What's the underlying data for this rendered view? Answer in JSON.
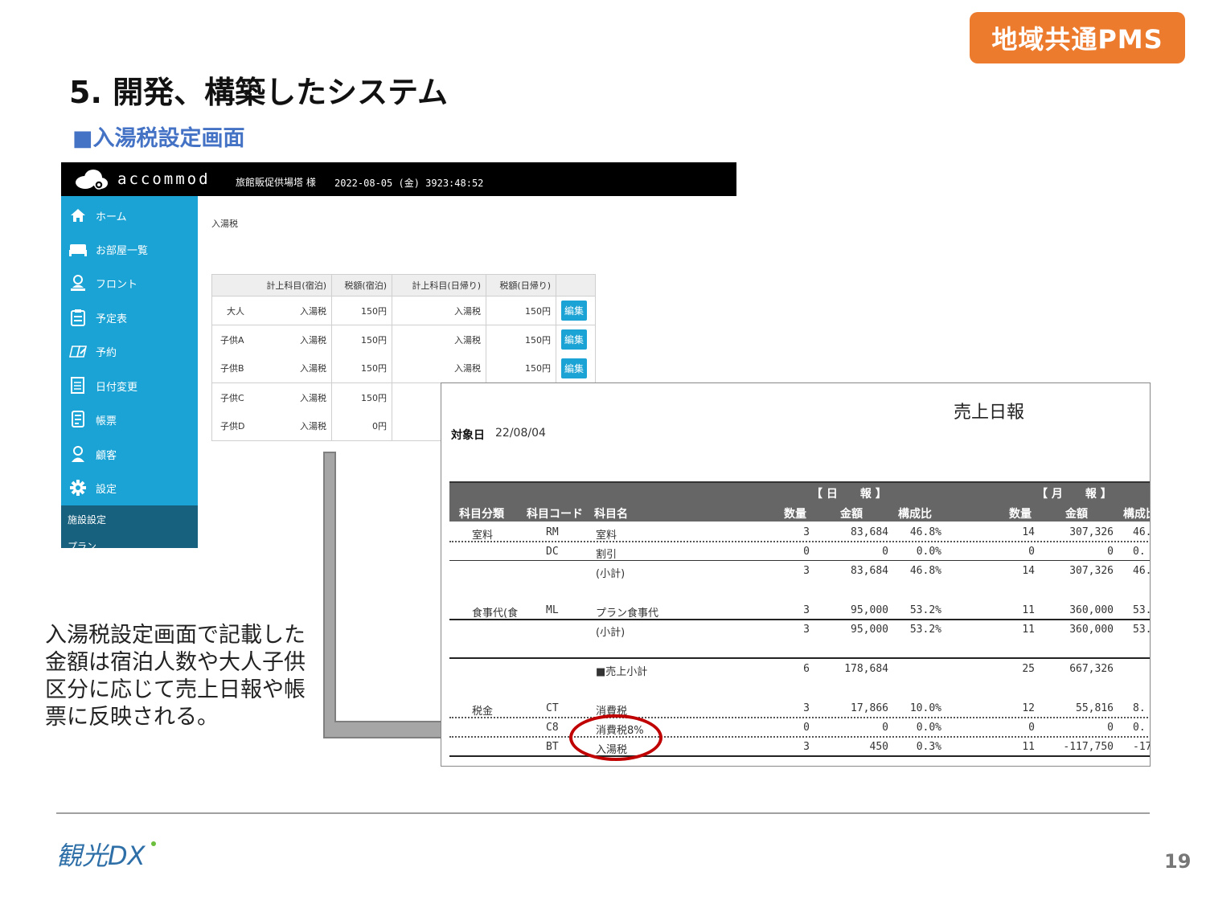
{
  "badge": "地域共通PMS",
  "slide_title": "5. 開発、構築したシステム",
  "subtitle": "■入湯税設定画面",
  "app": {
    "logo": "accommod",
    "facility": "旅館販促供場塔 様",
    "datetime": "2022-08-05 (金) 3923:48:52",
    "sidebar": [
      {
        "label": "ホーム",
        "icon": "home-icon"
      },
      {
        "label": "お部屋一覧",
        "icon": "bed-icon"
      },
      {
        "label": "フロント",
        "icon": "front-desk-icon"
      },
      {
        "label": "予定表",
        "icon": "clipboard-icon"
      },
      {
        "label": "予約",
        "icon": "book-edit-icon"
      },
      {
        "label": "日付変更",
        "icon": "document-icon"
      },
      {
        "label": "帳票",
        "icon": "report-icon"
      },
      {
        "label": "顧客",
        "icon": "user-icon"
      },
      {
        "label": "設定",
        "icon": "gear-icon"
      }
    ],
    "sidebar_section": "施設設定",
    "sidebar_section_next": "プラン",
    "page_heading": "入湯税",
    "table": {
      "headers": [
        "計上科目(宿泊)",
        "税額(宿泊)",
        "計上科目(日帰り)",
        "税額(日帰り)"
      ],
      "rows": [
        {
          "type": "大人",
          "item_stay": "入湯税",
          "tax_stay": "150円",
          "item_day": "入湯税",
          "tax_day": "150円",
          "edit": "編集"
        },
        {
          "type": "子供A",
          "item_stay": "入湯税",
          "tax_stay": "150円",
          "item_day": "入湯税",
          "tax_day": "150円",
          "edit": "編集"
        },
        {
          "type": "子供B",
          "item_stay": "入湯税",
          "tax_stay": "150円",
          "item_day": "入湯税",
          "tax_day": "150円",
          "edit": "編集"
        },
        {
          "type": "子供C",
          "item_stay": "入湯税",
          "tax_stay": "150円"
        },
        {
          "type": "子供D",
          "item_stay": "入湯税",
          "tax_stay": "0円"
        }
      ]
    }
  },
  "report": {
    "title": "売上日報",
    "date_label": "対象日",
    "date_value": "22/08/04",
    "group_day": "【 日　　報 】",
    "group_month": "【 月　　報 】",
    "columns": [
      "科目分類",
      "科目コード",
      "科目名",
      "数量",
      "金額",
      "構成比",
      "数量",
      "金額",
      "構成比"
    ],
    "rows": [
      {
        "cat": "室料",
        "code": "RM",
        "name": "室料",
        "dq": "3",
        "da": "83,684",
        "dr": "46.8%",
        "mq": "14",
        "ma": "307,326",
        "mr": "46."
      },
      {
        "cat": "",
        "code": "DC",
        "name": "割引",
        "dq": "0",
        "da": "0",
        "dr": "0.0%",
        "mq": "0",
        "ma": "0",
        "mr": "0."
      },
      {
        "cat": "",
        "code": "",
        "name": "(小計)",
        "dq": "3",
        "da": "83,684",
        "dr": "46.8%",
        "mq": "14",
        "ma": "307,326",
        "mr": "46."
      },
      {
        "cat": "食事代(食",
        "code": "ML",
        "name": "プラン食事代",
        "dq": "3",
        "da": "95,000",
        "dr": "53.2%",
        "mq": "11",
        "ma": "360,000",
        "mr": "53."
      },
      {
        "cat": "",
        "code": "",
        "name": "(小計)",
        "dq": "3",
        "da": "95,000",
        "dr": "53.2%",
        "mq": "11",
        "ma": "360,000",
        "mr": "53."
      },
      {
        "cat": "",
        "code": "",
        "name": "■売上小計",
        "dq": "6",
        "da": "178,684",
        "dr": "",
        "mq": "25",
        "ma": "667,326",
        "mr": ""
      },
      {
        "cat": "税金",
        "code": "CT",
        "name": "消費税",
        "dq": "3",
        "da": "17,866",
        "dr": "10.0%",
        "mq": "12",
        "ma": "55,816",
        "mr": "8."
      },
      {
        "cat": "",
        "code": "C8",
        "name": "消費税8%",
        "dq": "0",
        "da": "0",
        "dr": "0.0%",
        "mq": "0",
        "ma": "0",
        "mr": "0."
      },
      {
        "cat": "",
        "code": "BT",
        "name": "入湯税",
        "dq": "3",
        "da": "450",
        "dr": "0.3%",
        "mq": "11",
        "ma": "-117,750",
        "mr": "-17."
      }
    ]
  },
  "note": "入湯税設定画面で記載した金額は宿泊人数や大人子供区分に応じて売上日報や帳票に反映される。",
  "footer": {
    "logo_text": "観光DX",
    "page_number": "19"
  },
  "colors": {
    "badge": "#ec7b2d",
    "subtitle": "#4472c4",
    "sidebar": "#1aa3d4",
    "sidebar_dark": "#17617e",
    "highlight": "#c00000"
  }
}
